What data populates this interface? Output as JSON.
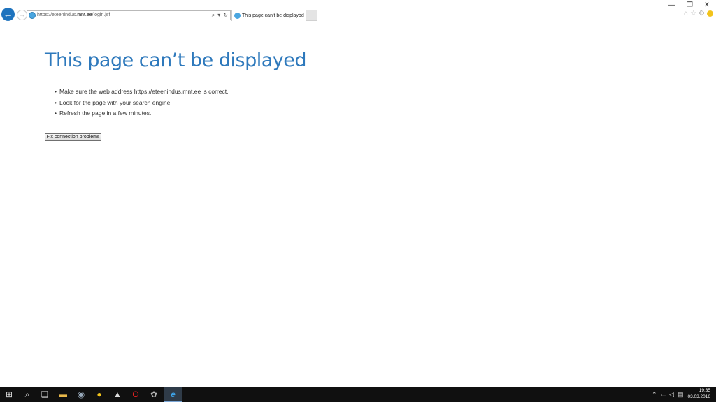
{
  "browser": {
    "address_url_prefix": "https://eteenindus.",
    "address_url_domain": "mnt.ee",
    "address_url_path": "/login.jsf",
    "tab_title": "This page can’t be displayed"
  },
  "icons": {
    "back": "back-arrow-icon",
    "forward": "forward-arrow-icon",
    "search": "search-icon",
    "refresh": "refresh-icon",
    "home": "home-icon",
    "favorites": "star-icon",
    "settings": "gear-icon",
    "feedback": "smiley-icon"
  },
  "page": {
    "title": "This page can’t be displayed",
    "tips": [
      "Make sure the web address https://eteenindus.mnt.ee is correct.",
      "Look for the page with your search engine.",
      "Refresh the page in a few minutes."
    ],
    "fix_button": "Fix connection problems"
  },
  "taskbar": {
    "time": "19:35",
    "date": "03.03.2016"
  },
  "colors": {
    "title_blue": "#2e79bc",
    "back_button_blue": "#1e73be",
    "taskbar": "#101010"
  }
}
